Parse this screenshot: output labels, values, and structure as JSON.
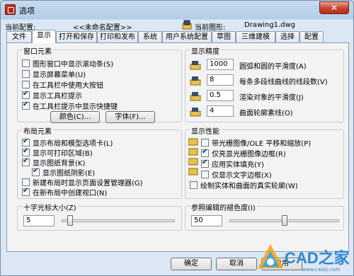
{
  "window": {
    "title": "选项",
    "close_label": "✕"
  },
  "info": {
    "profile_label": "当前配置:",
    "profile_value": "<<未命名配置>>",
    "drawing_label": "当前图形:",
    "drawing_value": "Drawing1.dwg"
  },
  "tabs": [
    "文件",
    "显示",
    "打开和保存",
    "打印和发布",
    "系统",
    "用户系统配置",
    "草图",
    "三维建模",
    "选择",
    "配置"
  ],
  "active_tab": "显示",
  "window_elements": {
    "title": "窗口元素",
    "options": [
      {
        "label": "图形窗口中显示滚动条(S)",
        "checked": false
      },
      {
        "label": "显示屏幕菜单(U)",
        "checked": false
      },
      {
        "label": "在工具栏中使用大按钮",
        "checked": false
      },
      {
        "label": "显示工具栏提示",
        "checked": true
      },
      {
        "label": "在工具栏提示中显示快捷键",
        "checked": true
      }
    ],
    "colors_button": "颜色(C)...",
    "fonts_button": "字体(F)..."
  },
  "display_resolution": {
    "title": "显示精度",
    "rows": [
      {
        "value": "1000",
        "label": "圆弧和圆的平滑度(A)"
      },
      {
        "value": "8",
        "label": "每条多段线曲线的线段数(V)"
      },
      {
        "value": "0.5",
        "label": "渲染对象的平滑度(J)"
      },
      {
        "value": "4",
        "label": "曲面轮廓素线(O)"
      }
    ]
  },
  "layout_elements": {
    "title": "布局元素",
    "options": [
      {
        "label": "显示布局和模型选项卡(L)",
        "checked": true,
        "indent": false
      },
      {
        "label": "显示可打印区域(B)",
        "checked": true,
        "indent": false
      },
      {
        "label": "显示图纸背景(K)",
        "checked": true,
        "indent": false
      },
      {
        "label": "显示图纸阴影(E)",
        "checked": true,
        "indent": true
      },
      {
        "label": "新建布局时显示页面设置管理器(G)",
        "checked": false,
        "indent": false
      },
      {
        "label": "在新布局中创建视口(N)",
        "checked": true,
        "indent": false
      }
    ]
  },
  "display_performance": {
    "title": "显示性能",
    "options": [
      {
        "label": "带光栅图像/OLE 平移和缩放(P)",
        "checked": false
      },
      {
        "label": "仅亮显光栅图像边框(R)",
        "checked": true
      },
      {
        "label": "应用实体填充(Y)",
        "checked": true
      },
      {
        "label": "仅显示文字边框(X)",
        "checked": false
      },
      {
        "label": "绘制实体和曲面的真实轮廓(W)",
        "checked": false
      }
    ]
  },
  "crosshair": {
    "title": "十字光标大小(Z)",
    "value": "5",
    "fraction": 0.05
  },
  "xref_fade": {
    "title": "参照编辑的褪色度(I)",
    "value": "50",
    "fraction": 0.5
  },
  "footer": {
    "ok": "确定",
    "cancel": "取消",
    "apply": "应用"
  },
  "watermark": {
    "text": "CAD之家",
    "url": "www.cadzj.com"
  },
  "colors": {
    "accent": "#2f86cf",
    "close": "#c7432b"
  }
}
